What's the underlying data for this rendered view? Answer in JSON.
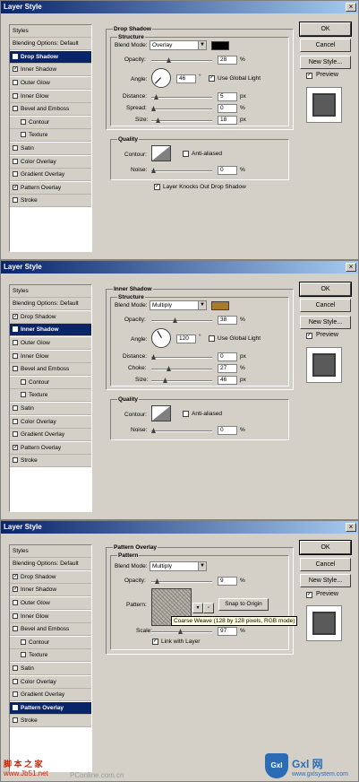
{
  "title": "Layer Style",
  "buttons": {
    "ok": "OK",
    "cancel": "Cancel",
    "new_style": "New Style...",
    "preview": "Preview"
  },
  "styles": [
    {
      "label": "Styles"
    },
    {
      "label": "Blending Options: Default"
    },
    {
      "label": "Drop Shadow"
    },
    {
      "label": "Inner Shadow"
    },
    {
      "label": "Outer Glow"
    },
    {
      "label": "Inner Glow"
    },
    {
      "label": "Bevel and Emboss"
    },
    {
      "label": "Contour"
    },
    {
      "label": "Texture"
    },
    {
      "label": "Satin"
    },
    {
      "label": "Color Overlay"
    },
    {
      "label": "Gradient Overlay"
    },
    {
      "label": "Pattern Overlay"
    },
    {
      "label": "Stroke"
    }
  ],
  "check_mark": "✓",
  "labels": {
    "structure": "Structure",
    "blend_mode": "Blend Mode:",
    "opacity": "Opacity:",
    "angle": "Angle:",
    "degree": "°",
    "use_global_light": "Use Global Light",
    "distance": "Distance:",
    "spread": "Spread:",
    "choke": "Choke:",
    "size": "Size:",
    "quality": "Quality",
    "contour": "Contour:",
    "anti_aliased": "Anti-aliased",
    "noise": "Noise:",
    "pattern_title": "Pattern",
    "pattern": "Pattern:",
    "scale": "Scale:",
    "snap_to_origin": "Snap to Origin",
    "link_with_layer": "Link with Layer",
    "percent": "%",
    "px": "px"
  },
  "drop_shadow": {
    "heading": "Drop Shadow",
    "blend_mode": "Overlay",
    "color": "#000000",
    "opacity": "28",
    "angle": "46",
    "use_global_light": true,
    "distance": "5",
    "spread": "0",
    "size": "18",
    "anti_aliased": false,
    "noise": "0",
    "knockout_label": "Layer Knocks Out Drop Shadow",
    "knockout": true
  },
  "inner_shadow": {
    "heading": "Inner Shadow",
    "blend_mode": "Multiply",
    "color": "#a87a2a",
    "opacity": "38",
    "angle": "120",
    "use_global_light": false,
    "distance": "0",
    "choke": "27",
    "size": "46",
    "anti_aliased": false,
    "noise": "0"
  },
  "pattern_overlay": {
    "heading": "Pattern Overlay",
    "blend_mode": "Multiply",
    "opacity": "9",
    "tooltip": "Coarse Weave (128 by 128 pixels, RGB mode)",
    "scale": "97",
    "link_with_layer": true
  },
  "watermarks": {
    "left_top": "脚 本 之 家",
    "left_bottom": "www.Jb51.net",
    "middle": "PConline.com.cn",
    "right_logo": "Gxl",
    "right_text": "Gxl 网",
    "right_url": "www.gxlsystem.com"
  },
  "colors": {
    "accent": "#0a246a",
    "dialog_bg": "#d4d0c8"
  }
}
